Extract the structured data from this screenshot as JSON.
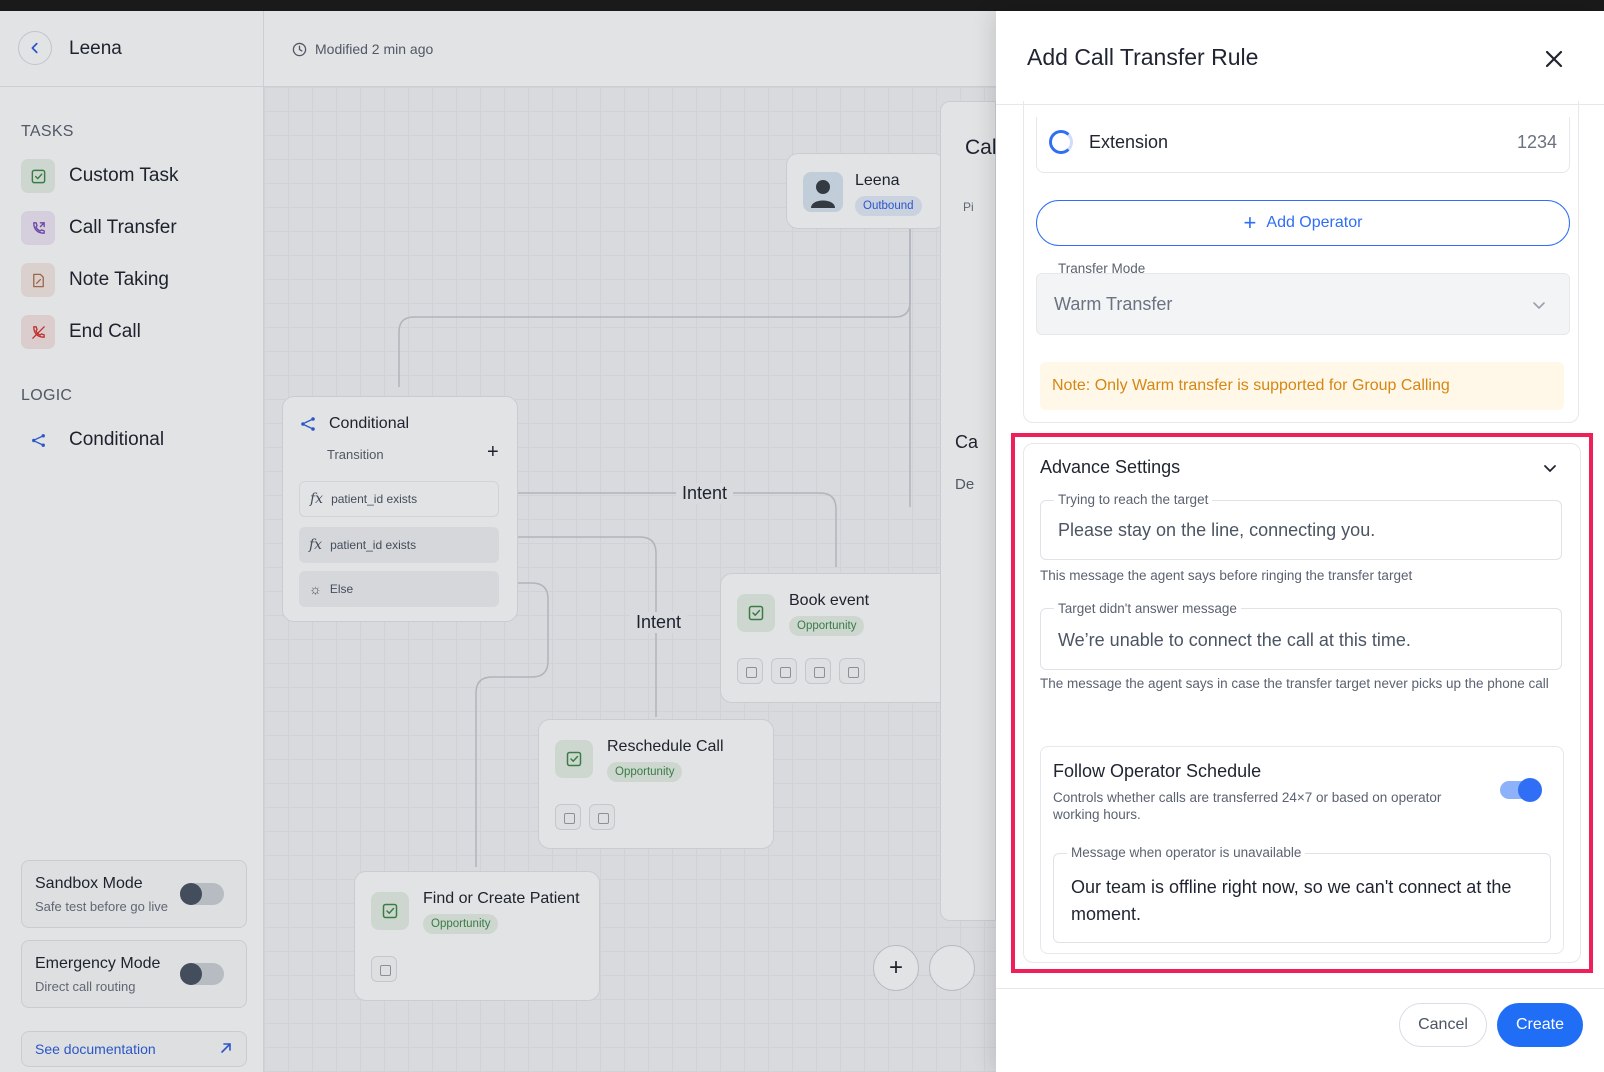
{
  "header": {
    "agent_name": "Leena",
    "modified": "Modified 2 min ago"
  },
  "sidebar": {
    "tasks_label": "TASKS",
    "tasks": [
      {
        "label": "Custom Task",
        "icon": "check-square-icon",
        "color": "#e7f2e8"
      },
      {
        "label": "Call Transfer",
        "icon": "phone-forward-icon",
        "color": "#efe7f7"
      },
      {
        "label": "Note Taking",
        "icon": "note-icon",
        "color": "#f6ebe6"
      },
      {
        "label": "End Call",
        "icon": "phone-off-icon",
        "color": "#f8e6e6"
      }
    ],
    "logic_label": "LOGIC",
    "logic": [
      {
        "label": "Conditional",
        "icon": "branch-icon"
      }
    ],
    "sandbox": {
      "title": "Sandbox Mode",
      "sub": "Safe test before go live"
    },
    "emergency": {
      "title": "Emergency Mode",
      "sub": "Direct call routing"
    },
    "docs": "See documentation"
  },
  "canvas": {
    "agent_node": {
      "name": "Leena",
      "badge": "Outbound"
    },
    "conditional": {
      "title": "Conditional",
      "transition": "Transition",
      "rows": [
        "patient_id exists",
        "patient_id exists",
        "Else"
      ]
    },
    "edges": [
      "Intent",
      "Intent"
    ],
    "nodes": [
      {
        "title": "Book event",
        "badge": "Opportunity"
      },
      {
        "title": "Reschedule Call",
        "badge": "Opportunity"
      },
      {
        "title": "Find or Create Patient",
        "badge": "Opportunity"
      }
    ],
    "behind_panel": {
      "t1": "Cal",
      "t2": "Pi",
      "t3": "Ca",
      "t4": "De"
    }
  },
  "drawer": {
    "title": "Add Call Transfer Rule",
    "extension": {
      "label": "Extension",
      "value": "1234"
    },
    "add_operator": "Add Operator",
    "transfer_mode": {
      "label": "Transfer Mode",
      "value": "Warm Transfer"
    },
    "note": "Note: Only Warm transfer is supported for Group Calling",
    "advance": {
      "title": "Advance Settings",
      "reach": {
        "label": "Trying to reach the target",
        "value": "Please stay on the line, connecting you.",
        "help": "This message the agent says before ringing the transfer target"
      },
      "no_answer": {
        "label": "Target didn't answer message",
        "value": "We’re unable to connect the call at this time.",
        "help": "The message the agent says in case the transfer target never picks up the phone call"
      },
      "schedule": {
        "title": "Follow Operator Schedule",
        "sub": "Controls whether calls are transferred 24×7 or based on operator working hours.",
        "enabled": true,
        "msg_label": "Message when operator is unavailable",
        "msg_value": "Our team is offline right now, so we can't connect at the moment."
      }
    },
    "cancel": "Cancel",
    "create": "Create"
  },
  "colors": {
    "accent": "#1f6ef5",
    "highlight": "#ef1f5a",
    "note_text": "#d68612",
    "note_bg": "#fff8e8"
  }
}
